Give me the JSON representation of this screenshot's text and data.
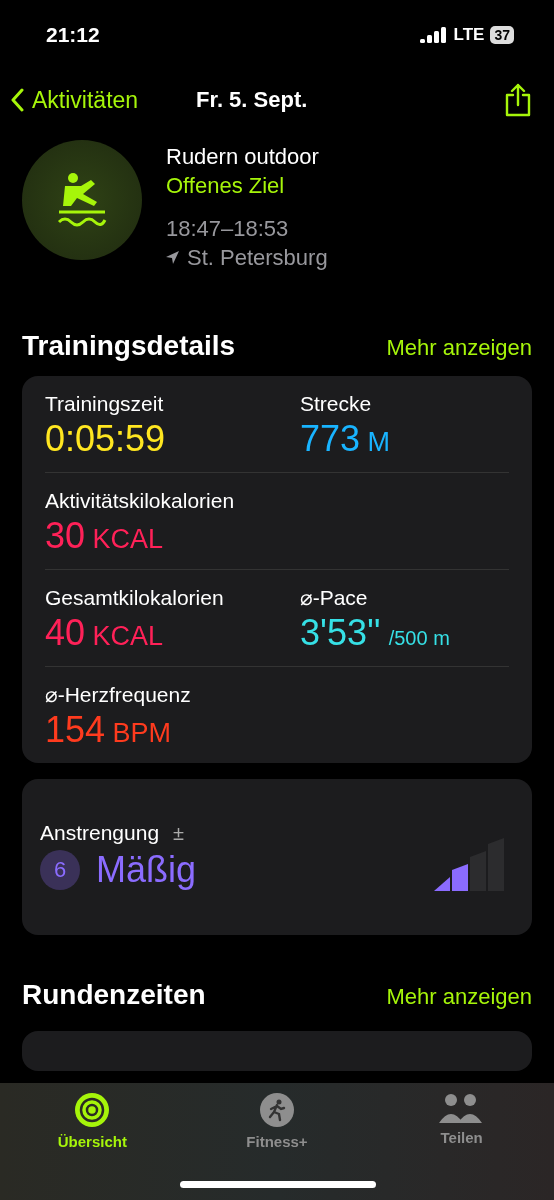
{
  "status_bar": {
    "time": "21:12",
    "network": "LTE",
    "battery": "37"
  },
  "nav": {
    "back": "Aktivitäten",
    "title": "Fr. 5. Sept."
  },
  "workout": {
    "name": "Rudern outdoor",
    "goal": "Offenes Ziel",
    "time_range": "18:47–18:53",
    "location": "St. Petersburg"
  },
  "details": {
    "title": "Trainingsdetails",
    "more": "Mehr anzeigen",
    "rows": [
      [
        {
          "label": "Trainingszeit",
          "value": "0:05:59",
          "color": "#ffe620"
        },
        {
          "label": "Strecke",
          "value": "773",
          "unit": "M",
          "color": "#19b4ff"
        }
      ],
      [
        {
          "label": "Aktivitätskilokalorien",
          "value": "30",
          "unit": "KCAL",
          "color": "#ff2158"
        }
      ],
      [
        {
          "label": "Gesamtkilokalorien",
          "value": "40",
          "unit": "KCAL",
          "color": "#ff2158"
        },
        {
          "label": "⌀-Pace",
          "value": "3'53''",
          "suffix": "/500 m",
          "color": "#36e0e6"
        }
      ],
      [
        {
          "label": "⌀-Herzfrequenz",
          "value": "154",
          "unit": "BPM",
          "color": "#ff3b1e"
        }
      ]
    ]
  },
  "effort": {
    "label": "Anstrengung",
    "adjust": "±",
    "score": "6",
    "rating": "Mäßig",
    "level": 0.5
  },
  "laps": {
    "title": "Rundenzeiten",
    "more": "Mehr anzeigen"
  },
  "tabs": [
    {
      "label": "Übersicht",
      "kind": "rings",
      "selected": true
    },
    {
      "label": "Fitness+",
      "kind": "runner",
      "selected": false
    },
    {
      "label": "Teilen",
      "kind": "people",
      "selected": false
    }
  ]
}
